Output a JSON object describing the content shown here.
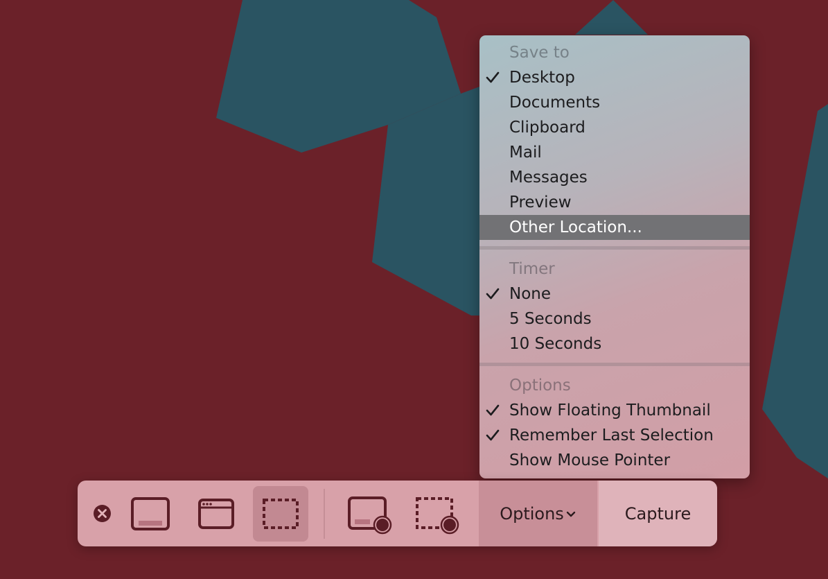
{
  "menu": {
    "save_to": {
      "header": "Save to",
      "items": [
        {
          "label": "Desktop",
          "checked": true
        },
        {
          "label": "Documents",
          "checked": false
        },
        {
          "label": "Clipboard",
          "checked": false
        },
        {
          "label": "Mail",
          "checked": false
        },
        {
          "label": "Messages",
          "checked": false
        },
        {
          "label": "Preview",
          "checked": false
        },
        {
          "label": "Other Location...",
          "checked": false,
          "highlighted": true
        }
      ]
    },
    "timer": {
      "header": "Timer",
      "items": [
        {
          "label": "None",
          "checked": true
        },
        {
          "label": "5 Seconds",
          "checked": false
        },
        {
          "label": "10 Seconds",
          "checked": false
        }
      ]
    },
    "options": {
      "header": "Options",
      "items": [
        {
          "label": "Show Floating Thumbnail",
          "checked": true
        },
        {
          "label": "Remember Last Selection",
          "checked": true
        },
        {
          "label": "Show Mouse Pointer",
          "checked": false
        }
      ]
    }
  },
  "toolbar": {
    "tools": [
      {
        "icon": "close-icon"
      },
      {
        "icon": "capture-entire-screen-icon"
      },
      {
        "icon": "capture-window-icon"
      },
      {
        "icon": "capture-selection-icon",
        "selected": true
      },
      {
        "icon": "record-entire-screen-icon"
      },
      {
        "icon": "record-selection-icon"
      }
    ],
    "options_label": "Options",
    "options_icon": "chevron-down-icon",
    "capture_label": "Capture"
  },
  "colors": {
    "wallpaper_red": "#6b2129",
    "wallpaper_teal": "#2a5462",
    "menu_highlight": "#727275",
    "toolbar_bg": "#d8a1a9",
    "icon_stroke": "#5a1d26"
  }
}
